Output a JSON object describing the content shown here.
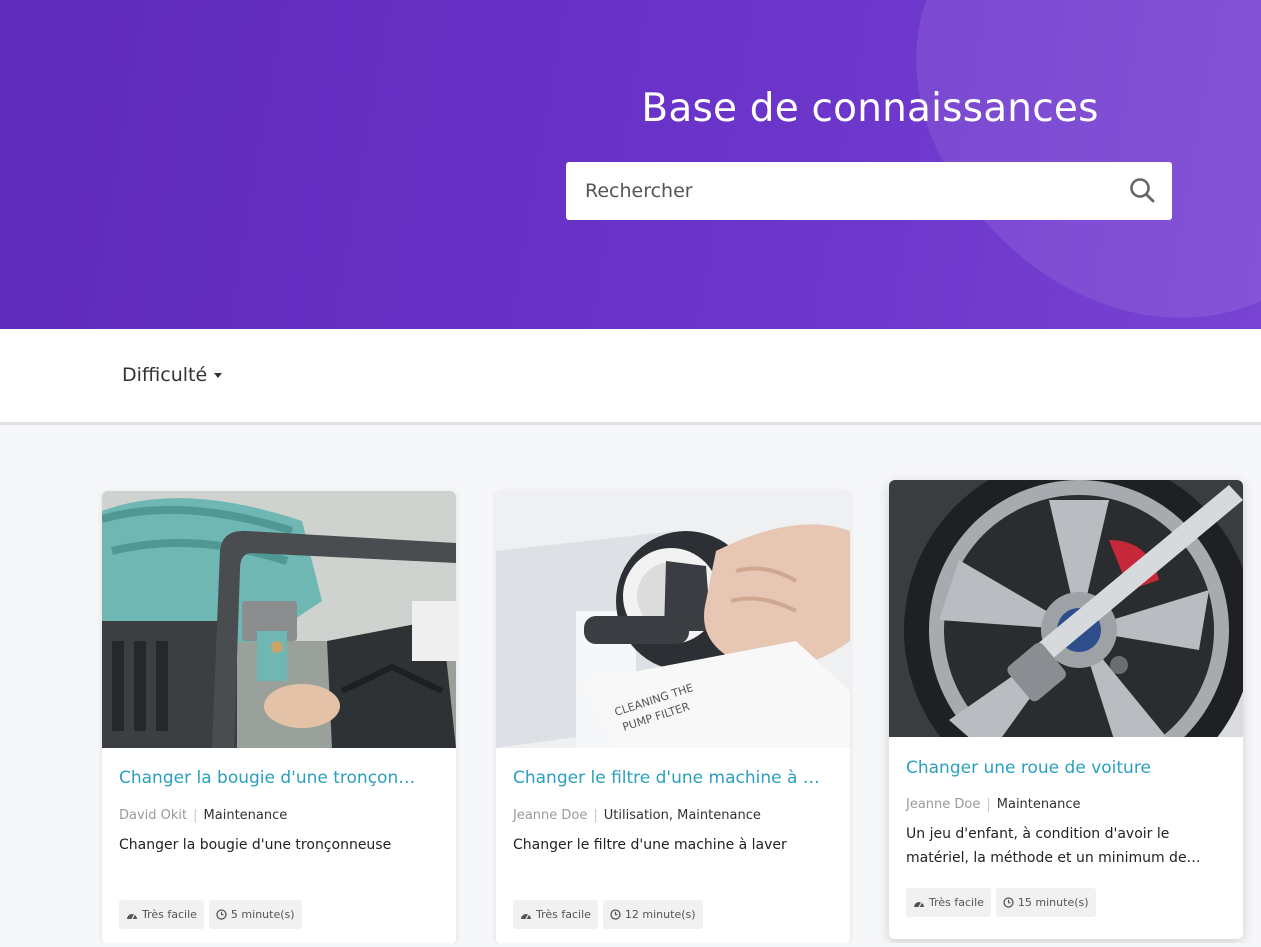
{
  "header": {
    "title": "Base de connaissances",
    "search_placeholder": "Rechercher",
    "accent_color": "#6530c2"
  },
  "filters": {
    "difficulty_label": "Difficulté"
  },
  "articles": [
    {
      "title": "Changer la bougie d'une tronçon…",
      "author": "David Okit",
      "categories": "Maintenance",
      "description": "Changer la bougie d'une tronçonneuse",
      "difficulty": "Très facile",
      "duration": "5 minute(s)"
    },
    {
      "title": "Changer le filtre d'une machine à …",
      "author": "Jeanne Doe",
      "categories": "Utilisation, Maintenance",
      "description": "Changer le filtre d'une machine à laver",
      "difficulty": "Très facile",
      "duration": "12 minute(s)"
    },
    {
      "title": "Changer une roue de voiture",
      "author": "Jeanne Doe",
      "categories": "Maintenance",
      "description": "Un jeu d'enfant, à condition d'avoir le matériel, la méthode et un minimum de…",
      "difficulty": "Très facile",
      "duration": "15 minute(s)"
    }
  ]
}
